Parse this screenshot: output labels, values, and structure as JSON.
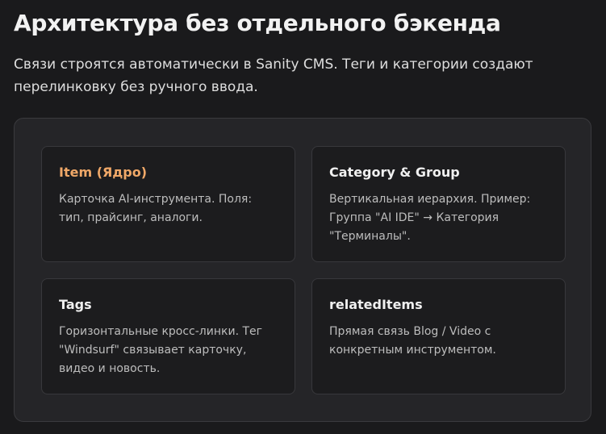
{
  "header": {
    "title": "Архитектура без отдельного бэкенда",
    "intro": "Связи строятся автоматически в Sanity CMS. Теги и категории создают перелинковку без ручного ввода."
  },
  "colors": {
    "accent": "#f0a868",
    "background": "#1a1a1c",
    "panel": "#252528",
    "card": "#1c1c1e"
  },
  "cards": [
    {
      "title": "Item (Ядро)",
      "text": "Карточка AI-инструмента. Поля: тип, прайсинг, аналоги."
    },
    {
      "title": "Category & Group",
      "text": "Вертикальная иерархия. Пример: Группа \"AI IDE\" → Категория \"Терминалы\"."
    },
    {
      "title": "Tags",
      "text": "Горизонтальные кросс-линки. Тег \"Windsurf\" связывает карточку, видео и новость."
    },
    {
      "title": "relatedItems",
      "text": "Прямая связь Blog / Video с конкретным инструментом."
    }
  ]
}
